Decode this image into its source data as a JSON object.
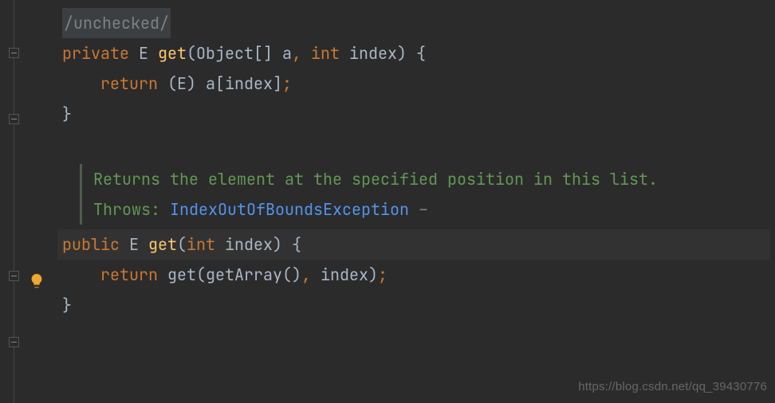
{
  "code": {
    "suppress": "/unchecked/",
    "kw_private": "private",
    "kw_public": "public",
    "kw_int": "int",
    "kw_return": "return",
    "type_E": "E",
    "type_Object": "Object",
    "method_get": "get",
    "method_getArray": "getArray",
    "param_a": "a",
    "param_index": "index",
    "lparen": "(",
    "rparen": ")",
    "lbrace": "{",
    "rbrace": "}",
    "lbracket": "[",
    "rbracket": "]",
    "brackets": "[]",
    "semi": ";",
    "comma": ",",
    "space": " ",
    "dash": "–"
  },
  "doc": {
    "summary": "Returns the element at the specified position in this list.",
    "throws_label": "Throws:",
    "throws_type": "IndexOutOfBoundsException"
  },
  "watermark": "https://blog.csdn.net/qq_39430776"
}
